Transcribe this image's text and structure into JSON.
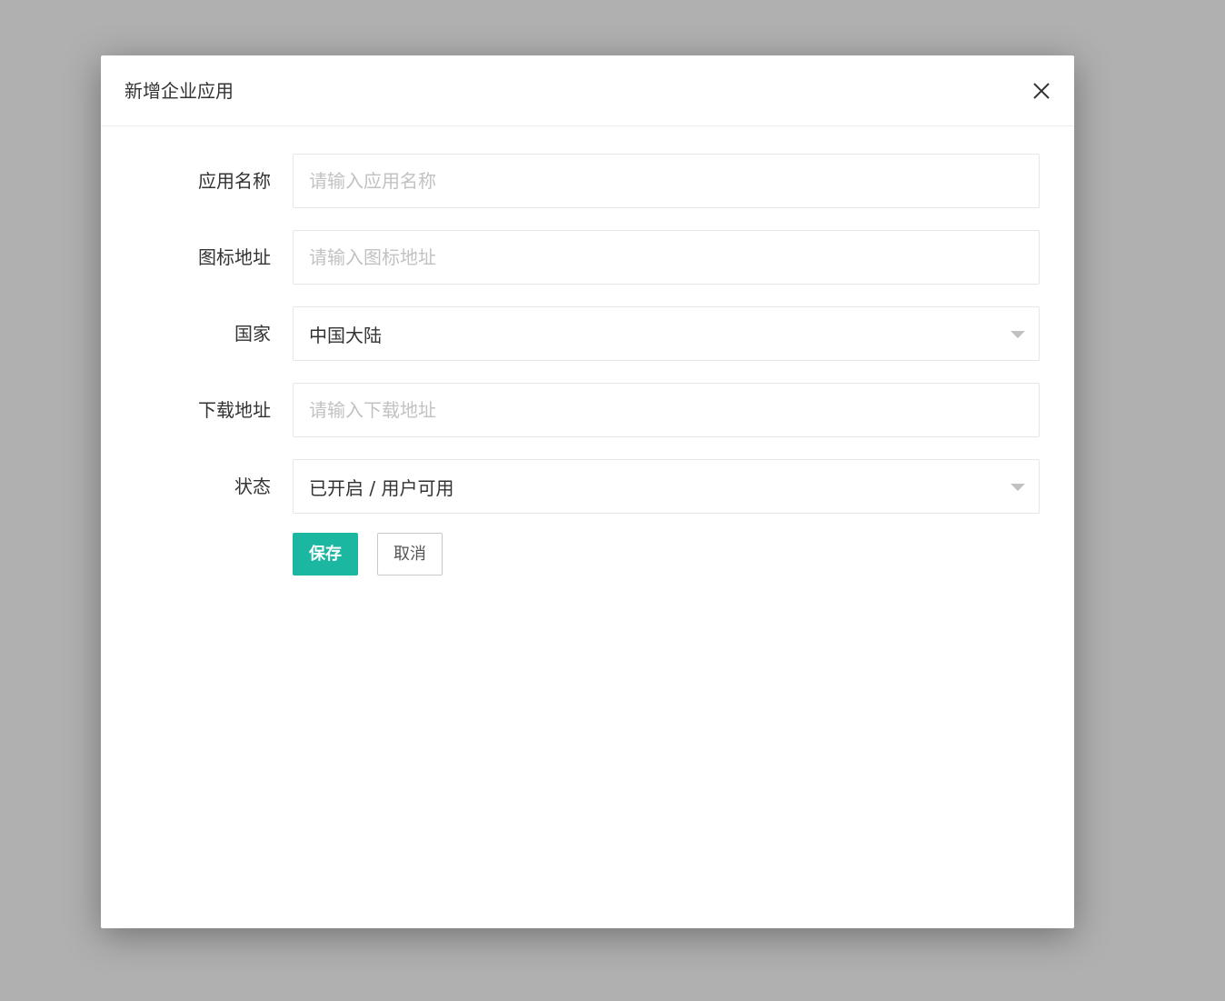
{
  "modal": {
    "title": "新增企业应用"
  },
  "form": {
    "fields": [
      {
        "label": "应用名称",
        "placeholder": "请输入应用名称",
        "value": ""
      },
      {
        "label": "图标地址",
        "placeholder": "请输入图标地址",
        "value": ""
      },
      {
        "label": "国家",
        "selected": "中国大陆"
      },
      {
        "label": "下载地址",
        "placeholder": "请输入下载地址",
        "value": ""
      },
      {
        "label": "状态",
        "selected": "已开启 / 用户可用"
      }
    ],
    "save_label": "保存",
    "cancel_label": "取消"
  },
  "colors": {
    "primary": "#1cb7a0",
    "overlay": "#b0b0b0",
    "placeholder": "#c2c2c2",
    "border": "#e6e6e6"
  },
  "icons": {
    "close": "close-icon",
    "dropdown": "caret-down-icon"
  }
}
